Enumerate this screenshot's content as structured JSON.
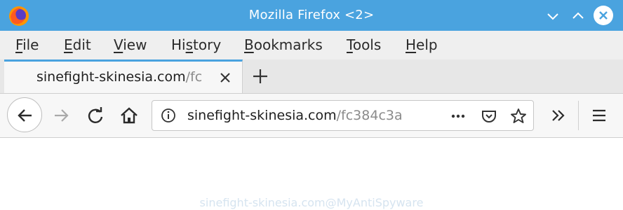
{
  "window": {
    "title": "Mozilla Firefox <2>",
    "colors": {
      "titlebar": "#4aa3df",
      "accent": "#4aa3df"
    }
  },
  "menubar": {
    "items": [
      {
        "underline": "F",
        "rest": "ile"
      },
      {
        "underline": "E",
        "rest": "dit"
      },
      {
        "underline": "V",
        "rest": "iew"
      },
      {
        "pre": "Hi",
        "underline": "s",
        "rest": "tory"
      },
      {
        "underline": "B",
        "rest": "ookmarks"
      },
      {
        "underline": "T",
        "rest": "ools"
      },
      {
        "underline": "H",
        "rest": "elp"
      }
    ]
  },
  "tab": {
    "title_domain": "sinefight-skinesia.com",
    "title_path": "/fc"
  },
  "urlbar": {
    "domain": "sinefight-skinesia.com",
    "path": "/fc384c3a"
  },
  "watermark": "sinefight-skinesia.com@MyAntiSpyware"
}
